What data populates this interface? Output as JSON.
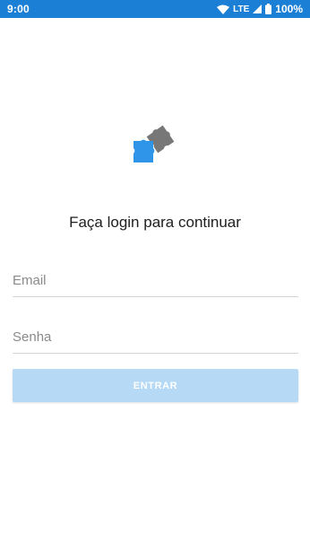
{
  "status_bar": {
    "time": "9:00",
    "network": "LTE",
    "battery": "100%",
    "background_color": "#1b7fd6"
  },
  "logo": {
    "icon": "puzzle-pieces-icon",
    "colors": {
      "blue_piece": "#2f95e8",
      "gray_piece": "#777777"
    }
  },
  "login": {
    "title": "Faça login para continuar",
    "email_placeholder": "Email",
    "email_value": "",
    "password_placeholder": "Senha",
    "password_value": "",
    "submit_label": "ENTRAR",
    "submit_color": "#b6d9f6"
  }
}
